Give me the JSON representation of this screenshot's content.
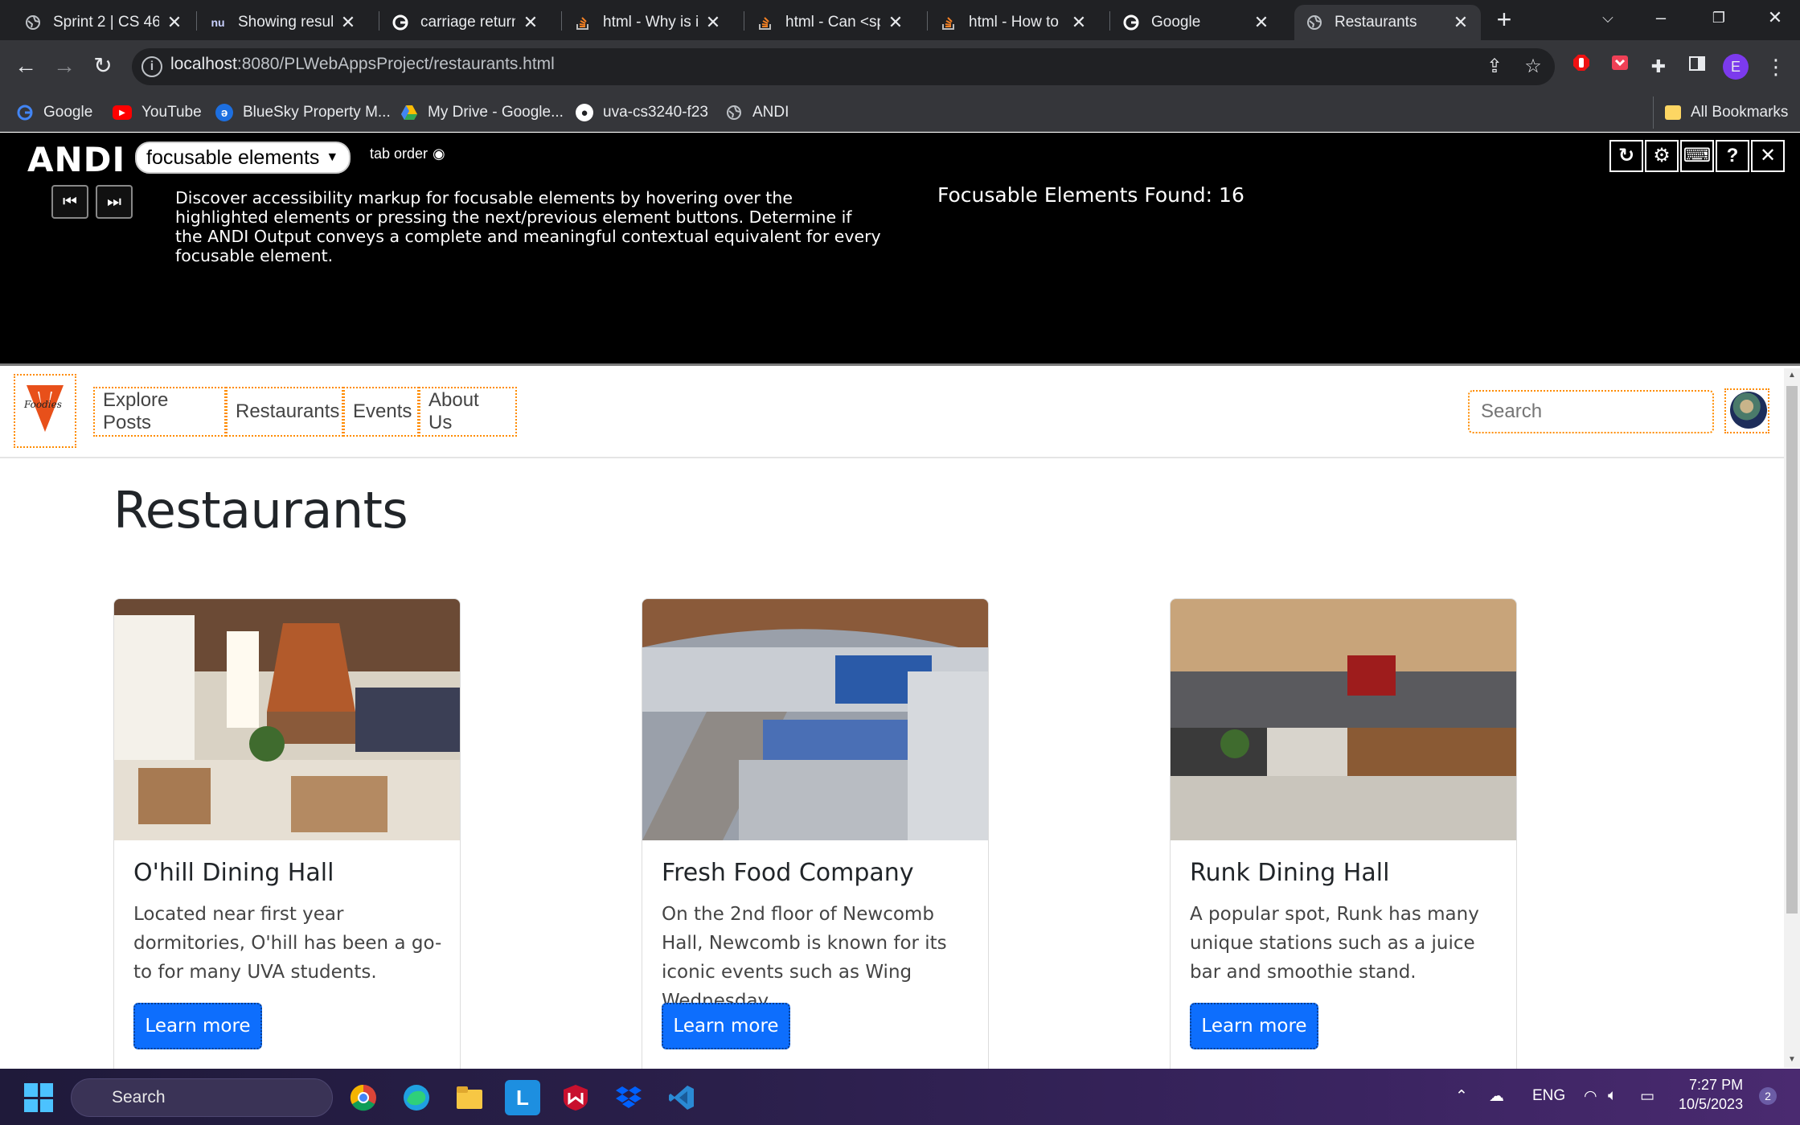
{
  "browser": {
    "tabs": [
      {
        "title": "Sprint 2 | CS 46",
        "favicon": "globe-icon"
      },
      {
        "title": "Showing results",
        "favicon": "nu"
      },
      {
        "title": "carriage return i",
        "favicon": "google-icon"
      },
      {
        "title": "html - Why is it",
        "favicon": "stackoverflow-icon"
      },
      {
        "title": "html - Can <spa",
        "favicon": "stackoverflow-icon"
      },
      {
        "title": "html - How to m",
        "favicon": "stackoverflow-icon"
      },
      {
        "title": "Google",
        "favicon": "google-icon"
      },
      {
        "title": "Restaurants",
        "favicon": "globe-icon",
        "active": true
      }
    ],
    "url_host": "localhost",
    "url_path": ":8080/PLWebAppsProject/restaurants.html",
    "profile_initial": "E",
    "bookmarks": [
      {
        "label": "Google"
      },
      {
        "label": "YouTube"
      },
      {
        "label": "BlueSky Property M..."
      },
      {
        "label": "My Drive - Google..."
      },
      {
        "label": "uva-cs3240-f23"
      },
      {
        "label": "ANDI"
      }
    ],
    "all_bookmarks": "All Bookmarks",
    "nu_glyph": "nu"
  },
  "andi": {
    "logo": "ANDI",
    "mode": "focusable elements",
    "tab_order": "tab order",
    "description": "Discover accessibility markup for focusable elements by hovering over the highlighted elements or pressing the next/previous element buttons. Determine if the ANDI Output conveys a complete and meaningful contextual equivalent for every focusable element.",
    "found": "Focusable Elements Found: 16",
    "help_glyph": "?"
  },
  "site": {
    "logo_text": "Foodies",
    "nav": [
      "Explore Posts",
      "Restaurants",
      "Events",
      "About Us"
    ],
    "search_placeholder": "Search"
  },
  "main": {
    "title": "Restaurants",
    "cards": [
      {
        "title": "O'hill Dining Hall",
        "text": "Located near first year dormitories, O'hill has been a go-to for many UVA students.",
        "button": "Learn more"
      },
      {
        "title": "Fresh Food Company",
        "text": "On the 2nd floor of Newcomb Hall, Newcomb is known for its iconic events such as Wing Wednesday.",
        "button": "Learn more"
      },
      {
        "title": "Runk Dining Hall",
        "text": "A popular spot, Runk has many unique stations such as a juice bar and smoothie stand.",
        "button": "Learn more"
      }
    ]
  },
  "taskbar": {
    "search": "Search",
    "language": "ENG",
    "time": "7:27 PM",
    "date": "10/5/2023",
    "notifications": "2",
    "app_l_glyph": "L"
  },
  "colors": {
    "accent": "#0d6efd",
    "focus_outline": "#ff8c00",
    "logo_orange": "#e8501a"
  }
}
